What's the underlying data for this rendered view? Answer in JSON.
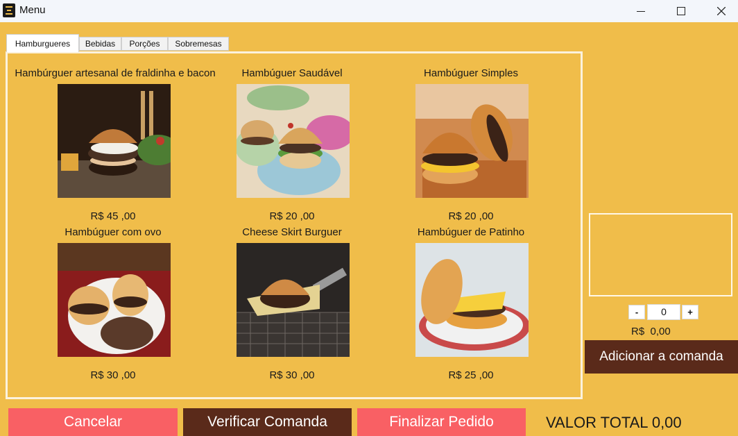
{
  "window": {
    "title": "Menu"
  },
  "tabs": [
    {
      "label": "Hamburgueres",
      "active": true
    },
    {
      "label": "Bebidas",
      "active": false
    },
    {
      "label": "Porções",
      "active": false
    },
    {
      "label": "Sobremesas",
      "active": false
    }
  ],
  "items": [
    {
      "name": "Hambúrguer artesanal de fraldinha e bacon",
      "price": "R$ 45 ,00"
    },
    {
      "name": "Hambúguer Saudável",
      "price": "R$ 20 ,00"
    },
    {
      "name": "Hambúguer Simples",
      "price": "R$ 20 ,00"
    },
    {
      "name": "Hambúguer com ovo",
      "price": "R$ 30 ,00"
    },
    {
      "name": "Cheese Skirt Burguer",
      "price": "R$ 30 ,00"
    },
    {
      "name": "Hambúguer de Patinho",
      "price": "R$ 25 ,00"
    }
  ],
  "order": {
    "minus_label": "-",
    "plus_label": "+",
    "quantity": "0",
    "unit_price": "R$  0,00",
    "add_label": "Adicionar a comanda"
  },
  "footer": {
    "cancel_label": "Cancelar",
    "verify_label": "Verificar Comanda",
    "finish_label": "Finalizar Pedido",
    "total_text": "VALOR TOTAL 0,00"
  },
  "colors": {
    "background": "#f0bd4a",
    "dark_button": "#5a2a1a",
    "red_button": "#f96064"
  }
}
